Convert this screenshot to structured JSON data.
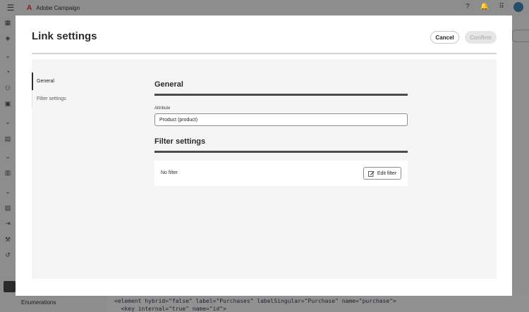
{
  "app": {
    "name": "Adobe Campaign",
    "logo_mark": "A"
  },
  "background": {
    "bottom_item": "Enumerations",
    "code_lines": [
      "<element hybrid=\"false\" label=\"Purchases\" labelSingular=\"Purchase\" name=\"purchase\">",
      "  <key internal=\"true\" name=\"id\">"
    ]
  },
  "modal": {
    "title": "Link settings",
    "cancel_label": "Cancel",
    "confirm_label": "Confirm",
    "nav": [
      {
        "label": "General",
        "selected": true
      },
      {
        "label": "Filter settings",
        "selected": false
      }
    ],
    "general": {
      "title": "General",
      "attribute_label": "Attribute",
      "attribute_value": "Product (product)"
    },
    "filter": {
      "title": "Filter settings",
      "status": "No filter",
      "edit_label": "Edit filter"
    }
  },
  "icons": {
    "topbar": [
      "menu-icon",
      "help-icon",
      "notification-icon",
      "apps-icon",
      "avatar"
    ],
    "edit_filter": "edit-icon"
  }
}
